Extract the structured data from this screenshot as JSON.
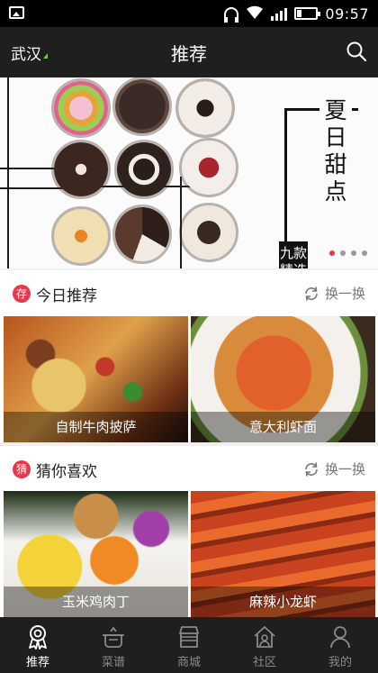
{
  "status_bar": {
    "time": "09:57"
  },
  "header": {
    "city": "武汉",
    "title": "推荐"
  },
  "banner": {
    "headline": "夏日甜点",
    "sub": "九款精选",
    "dot_count": 4,
    "active_dot": 1
  },
  "sections": [
    {
      "badge": "存",
      "title": "今日推荐",
      "refresh": "换一换",
      "cards": [
        {
          "caption": "自制牛肉披萨"
        },
        {
          "caption": "意大利虾面"
        }
      ]
    },
    {
      "badge": "猜",
      "title": "猜你喜欢",
      "refresh": "换一换",
      "cards": [
        {
          "caption": "玉米鸡肉丁"
        },
        {
          "caption": "麻辣小龙虾"
        }
      ]
    }
  ],
  "nav": [
    {
      "label": "推荐",
      "icon": "badge-ribbon-icon",
      "active": true
    },
    {
      "label": "菜谱",
      "icon": "pot-icon",
      "active": false
    },
    {
      "label": "商城",
      "icon": "store-icon",
      "active": false
    },
    {
      "label": "社区",
      "icon": "community-house-icon",
      "active": false
    },
    {
      "label": "我的",
      "icon": "profile-icon",
      "active": false
    }
  ],
  "colors": {
    "accent": "#e8394b",
    "bar": "#1f1f1f",
    "city_marker": "#7ac943"
  }
}
